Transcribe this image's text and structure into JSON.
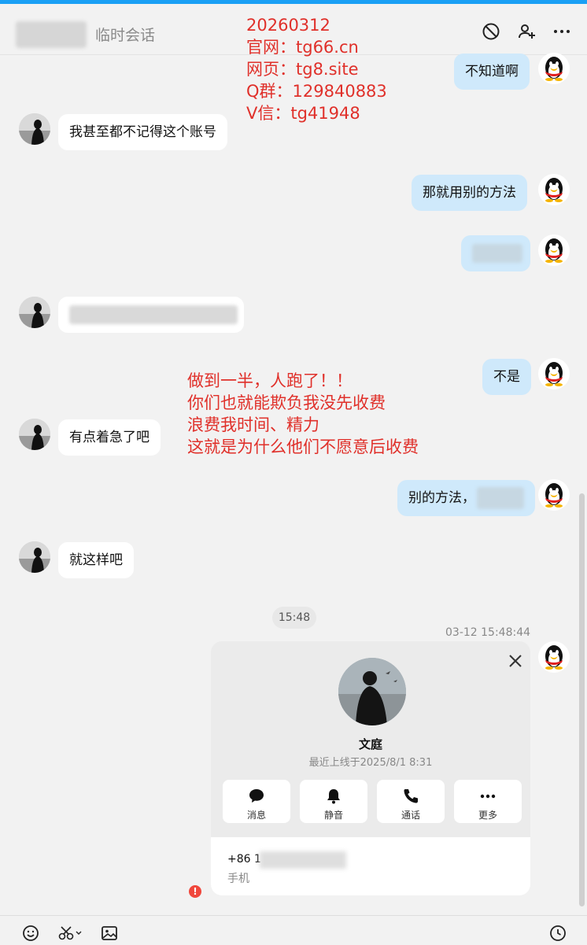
{
  "header": {
    "title": "临时会话"
  },
  "overlay_watermark": [
    "20260312",
    "官网：tg66.cn",
    "网页：tg8.site",
    "Q群：129840883",
    "V信：tg41948"
  ],
  "overlay_note": [
    "做到一半，人跑了！！",
    "你们也就能欺负我没先收费",
    "浪费我时间、精力",
    "这就是为什么他们不愿意后收费"
  ],
  "messages": [
    {
      "side": "out",
      "text": "不知道啊"
    },
    {
      "side": "in",
      "text": "我甚至都不记得这个账号"
    },
    {
      "side": "out",
      "text": "那就用别的方法"
    },
    {
      "side": "out",
      "text": ""
    },
    {
      "side": "in",
      "text": ""
    },
    {
      "side": "out",
      "text": "不是"
    },
    {
      "side": "in",
      "text": "有点着急了吧"
    },
    {
      "side": "out",
      "text": "别的方法，"
    },
    {
      "side": "in",
      "text": "就这样吧"
    }
  ],
  "time_pill": "15:48",
  "send_stamp": "03-12 15:48:44",
  "contact_card": {
    "name": "文庭",
    "last_seen": "最近上线于2025/8/1 8:31",
    "actions": [
      {
        "label": "消息",
        "icon": "chat-bubble-icon"
      },
      {
        "label": "静音",
        "icon": "bell-icon"
      },
      {
        "label": "通话",
        "icon": "phone-icon"
      },
      {
        "label": "更多",
        "icon": "more-dots-icon"
      }
    ],
    "phone_prefix": "+86 1",
    "phone_label": "手机"
  },
  "error_mark": "!",
  "colors": {
    "accent": "#1aa0f5",
    "outgoing_bubble": "#cfe9fb",
    "overlay_text": "#e0302a",
    "error": "#f0473c"
  }
}
